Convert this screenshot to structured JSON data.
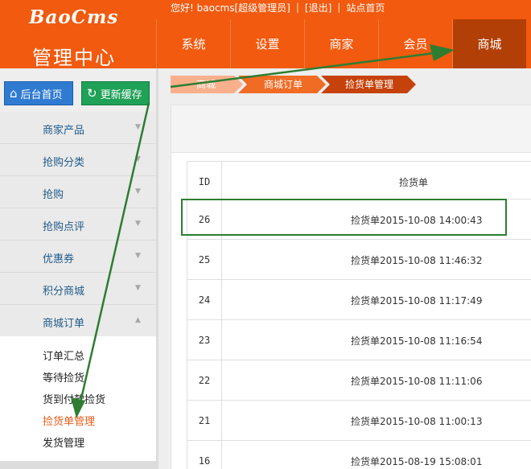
{
  "header": {
    "logo": "BaoCms",
    "title": "管理中心",
    "topbar": {
      "greeting": "您好! baocms[超级管理员]",
      "logout": "[退出]",
      "site_home": "站点首页"
    },
    "nav": [
      {
        "label": "系统"
      },
      {
        "label": "设置"
      },
      {
        "label": "商家"
      },
      {
        "label": "会员"
      },
      {
        "label": "商城"
      }
    ]
  },
  "sidebar": {
    "home_button": "后台首页",
    "cache_button": "更新缓存",
    "menu": [
      {
        "label": "商家产品"
      },
      {
        "label": "抢购分类"
      },
      {
        "label": "抢购"
      },
      {
        "label": "抢购点评"
      },
      {
        "label": "优惠券"
      },
      {
        "label": "积分商城"
      },
      {
        "label": "商城订单"
      }
    ],
    "submenu": [
      {
        "label": "订单汇总"
      },
      {
        "label": "等待捡货"
      },
      {
        "label": "货到付款捡货"
      },
      {
        "label": "捡货单管理"
      },
      {
        "label": "发货管理"
      }
    ]
  },
  "breadcrumb": [
    {
      "label": "商城"
    },
    {
      "label": "商城订单"
    },
    {
      "label": "捡货单管理"
    }
  ],
  "table": {
    "headers": {
      "id": "ID",
      "name": "捡货单"
    },
    "rows": [
      {
        "id": "26",
        "name": "捡货单2015-10-08 14:00:43"
      },
      {
        "id": "25",
        "name": "捡货单2015-10-08 11:46:32"
      },
      {
        "id": "24",
        "name": "捡货单2015-10-08 11:17:49"
      },
      {
        "id": "23",
        "name": "捡货单2015-10-08 11:16:54"
      },
      {
        "id": "22",
        "name": "捡货单2015-10-08 11:11:06"
      },
      {
        "id": "21",
        "name": "捡货单2015-10-08 11:00:13"
      },
      {
        "id": "16",
        "name": "捡货单2015-08-19 15:08:01"
      }
    ]
  },
  "colors": {
    "brand": "#f15a0f",
    "nav_active": "#b23f06",
    "annotation": "#2e7d32"
  }
}
